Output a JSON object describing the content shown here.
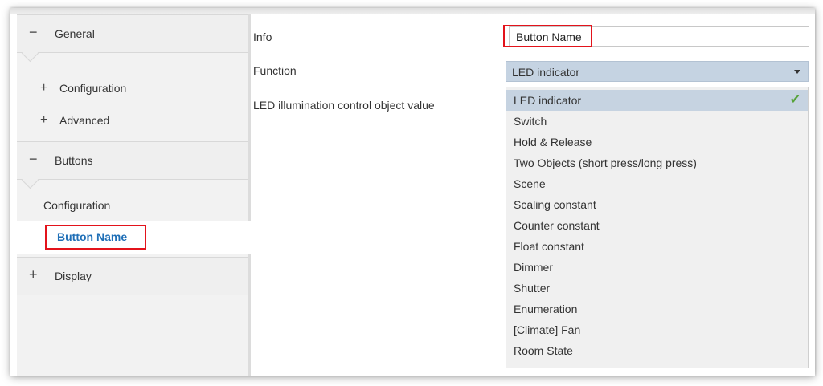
{
  "sidebar": {
    "general": {
      "sign": "−",
      "label": "General"
    },
    "general_items": [
      {
        "sign": "+",
        "label": "Configuration"
      },
      {
        "sign": "+",
        "label": "Advanced"
      }
    ],
    "buttons": {
      "sign": "−",
      "label": "Buttons"
    },
    "buttons_items": [
      {
        "label": "Configuration"
      },
      {
        "label": "Button Name"
      }
    ],
    "display": {
      "sign": "+",
      "label": "Display"
    }
  },
  "params": {
    "info_label": "Info",
    "info_value": "Button Name",
    "function_label": "Function",
    "function_value": "LED indicator",
    "led_label": "LED illumination control object value"
  },
  "dropdown": {
    "options": [
      "LED indicator",
      "Switch",
      "Hold & Release",
      "Two Objects (short press/long press)",
      "Scene",
      "Scaling constant",
      "Counter constant",
      "Float constant",
      "Dimmer",
      "Shutter",
      "Enumeration",
      "[Climate] Fan",
      "Room State"
    ],
    "selected_index": 0,
    "check_icon": "check-icon"
  },
  "colors": {
    "highlight": "#e3131b",
    "selected_text": "#1f6fb7",
    "select_bg": "#c5d3e2",
    "check": "#57a33b"
  }
}
